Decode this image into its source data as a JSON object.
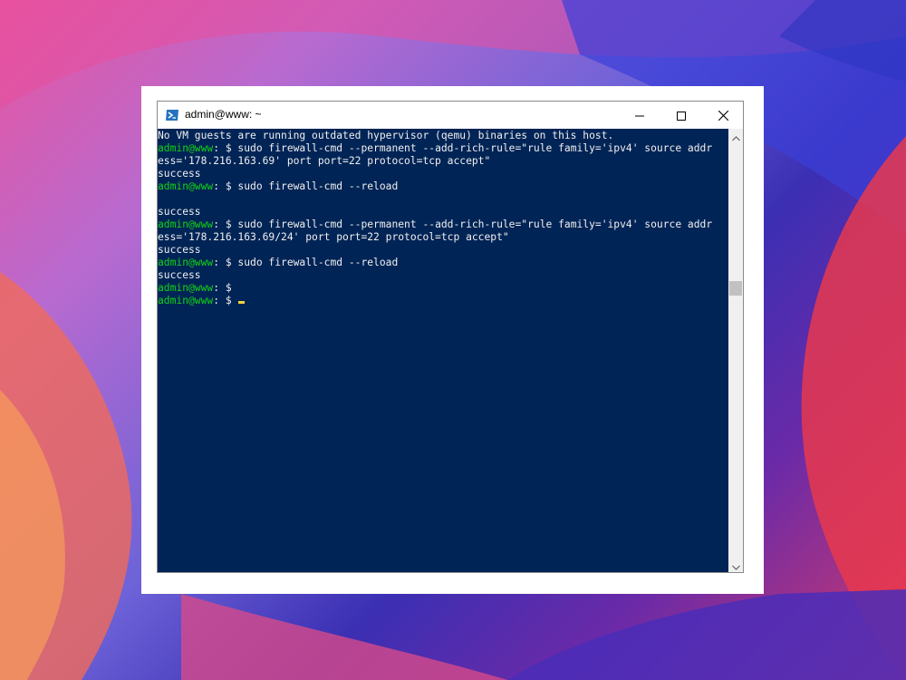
{
  "window": {
    "title": "admin@www: ~"
  },
  "terminal": {
    "lines": [
      {
        "prompt": "",
        "text": "No VM guests are running outdated hypervisor (qemu) binaries on this host."
      },
      {
        "prompt": "admin@www",
        "text": ": $ sudo firewall-cmd --permanent --add-rich-rule=\"rule family='ipv4' source addr"
      },
      {
        "prompt": "",
        "text": "ess='178.216.163.69' port port=22 protocol=tcp accept\""
      },
      {
        "prompt": "",
        "text": "success"
      },
      {
        "prompt": "admin@www",
        "text": ": $ sudo firewall-cmd --reload"
      },
      {
        "prompt": "",
        "text": ""
      },
      {
        "prompt": "",
        "text": "success"
      },
      {
        "prompt": "admin@www",
        "text": ": $ sudo firewall-cmd --permanent --add-rich-rule=\"rule family='ipv4' source addr"
      },
      {
        "prompt": "",
        "text": "ess='178.216.163.69/24' port port=22 protocol=tcp accept\""
      },
      {
        "prompt": "",
        "text": "success"
      },
      {
        "prompt": "admin@www",
        "text": ": $ sudo firewall-cmd --reload"
      },
      {
        "prompt": "",
        "text": "success"
      },
      {
        "prompt": "admin@www",
        "text": ": $"
      },
      {
        "prompt": "admin@www",
        "text": ": $ ",
        "cursor": true
      }
    ],
    "colors": {
      "background": "#012456",
      "text": "#f0f0f0",
      "prompt": "#13d313",
      "cursor": "#f5d142"
    }
  },
  "icons": {
    "app": "powershell-icon",
    "minimize": "minimize-icon",
    "maximize": "maximize-icon",
    "close": "close-icon",
    "scroll_up": "chevron-up-icon",
    "scroll_down": "chevron-down-icon"
  }
}
